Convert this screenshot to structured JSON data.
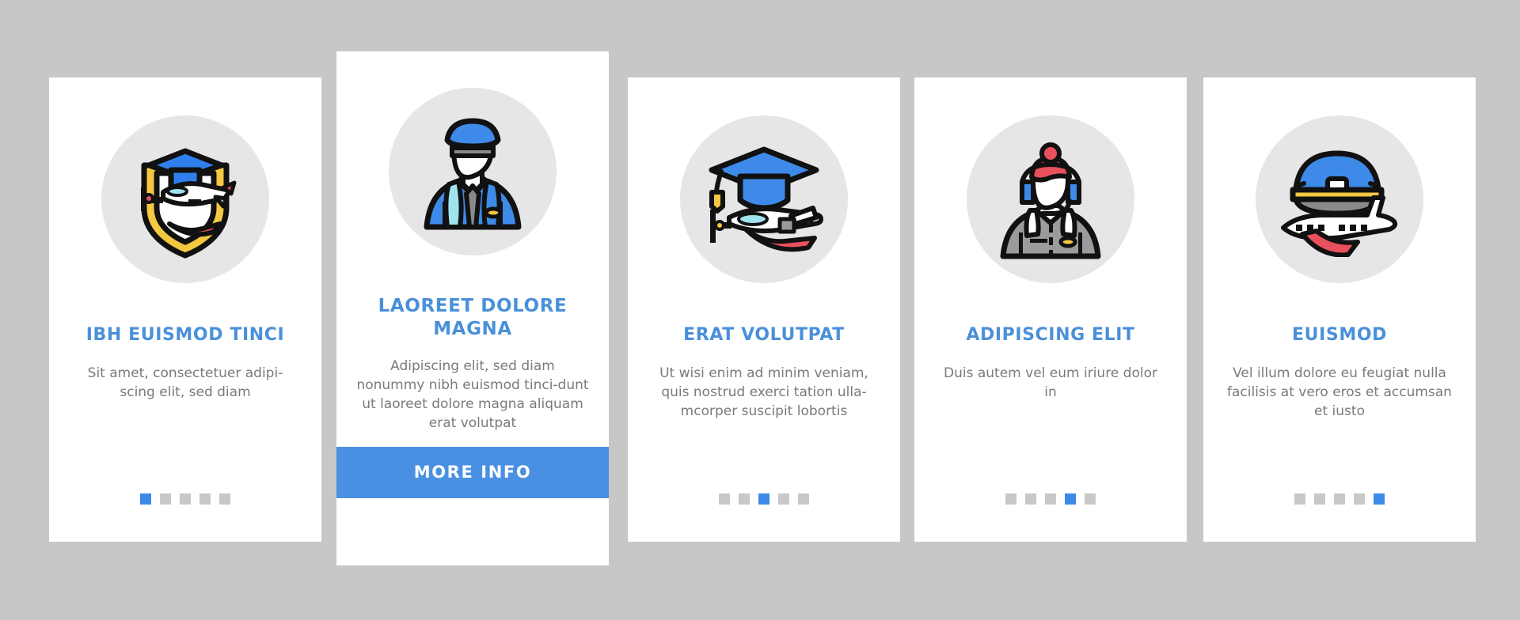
{
  "page": {
    "background_color": "#c7c7c7",
    "accent_color": "#4a90e2",
    "title_color": "#4a90d9",
    "body_text_color": "#7a7a7a",
    "icon_circle_color": "#e6e6e6",
    "dot_inactive_color": "#c8c8c8",
    "dot_active_color": "#3d8ae8",
    "total_steps": 5
  },
  "cards": [
    {
      "id": "card-1",
      "featured": false,
      "icon_name": "shield-airplane-graduation-icon",
      "title": "IBH EUISMOD TINCI",
      "description": "Sit amet, consectetuer adipi-scing elit, sed diam",
      "description_lines": [
        "Sit amet, consectetuer adipi-",
        "scing elit, sed diam"
      ],
      "active_dot": 1,
      "dots": 5
    },
    {
      "id": "card-2",
      "featured": true,
      "icon_name": "pilot-avatar-icon",
      "title": "LAOREET DOLORE MAGNA",
      "title_lines": [
        "LAOREET DOLORE",
        "MAGNA"
      ],
      "description": "Adipiscing elit, sed diam nonummy nibh euismod tinci-dunt ut laoreet dolore magna aliquam erat volutpat",
      "description_lines": [
        "Adipiscing elit, sed diam",
        "nonummy nibh euismod tinci-",
        "dunt ut laoreet dolore magna",
        "aliquam erat volutpat"
      ],
      "button_label": "MORE INFO",
      "active_dot": 2,
      "dots": 5
    },
    {
      "id": "card-3",
      "featured": false,
      "icon_name": "graduation-cap-propeller-plane-icon",
      "title": "ERAT VOLUTPAT",
      "description": "Ut wisi enim ad minim veniam, quis nostrud exerci tation ulla-mcorper suscipit lobortis",
      "description_lines": [
        "Ut wisi enim ad minim veniam,",
        "quis nostrud exerci tation ulla-",
        "mcorper suscipit lobortis"
      ],
      "active_dot": 3,
      "dots": 5
    },
    {
      "id": "card-4",
      "featured": false,
      "icon_name": "ground-crew-headset-avatar-icon",
      "title": "ADIPISCING ELIT",
      "description": "Duis autem vel eum iriure dolor in",
      "description_lines": [
        "Duis autem vel eum iriure",
        "dolor in"
      ],
      "active_dot": 4,
      "dots": 5
    },
    {
      "id": "card-5",
      "featured": false,
      "icon_name": "pilot-cap-airliner-icon",
      "title": "EUISMOD",
      "description": "Vel illum dolore eu feugiat nulla facilisis at vero eros et accumsan et iusto",
      "description_lines": [
        "Vel illum dolore eu feugiat",
        "nulla facilisis at vero eros et",
        "accumsan et iusto"
      ],
      "active_dot": 5,
      "dots": 5
    }
  ]
}
